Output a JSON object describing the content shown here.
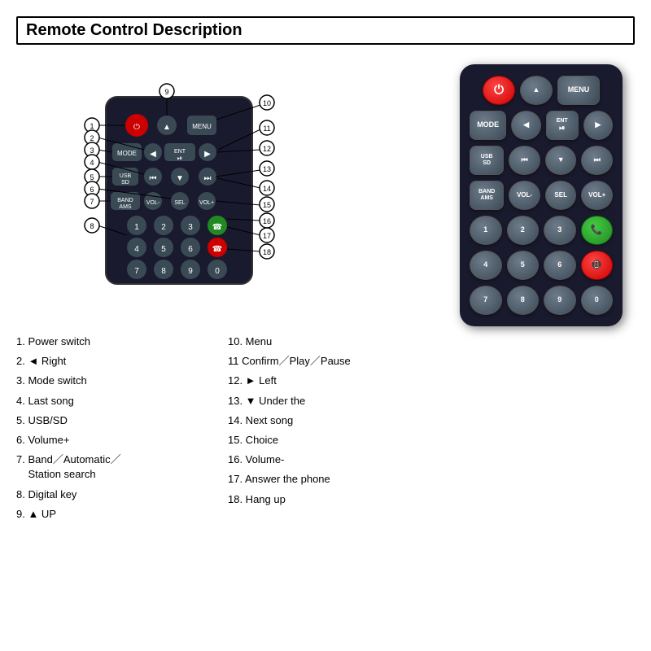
{
  "title": "Remote Control Description",
  "descriptions_left": [
    {
      "num": "1",
      "text": "Power switch"
    },
    {
      "num": "2",
      "text": "◄ Right"
    },
    {
      "num": "3",
      "text": "Mode switch"
    },
    {
      "num": "4",
      "text": "Last song"
    },
    {
      "num": "5",
      "text": "USB/SD"
    },
    {
      "num": "6",
      "text": "Volume+"
    },
    {
      "num": "7",
      "text": "Band／Automatic／Station search"
    },
    {
      "num": "8",
      "text": "Digital key"
    },
    {
      "num": "9",
      "text": "▲ UP"
    }
  ],
  "descriptions_right": [
    {
      "num": "10",
      "text": "Menu"
    },
    {
      "num": "11",
      "text": "Confirm／Play／Pause"
    },
    {
      "num": "12",
      "text": "► Left"
    },
    {
      "num": "13",
      "text": "▼ Under the"
    },
    {
      "num": "14",
      "text": "Next song"
    },
    {
      "num": "15",
      "text": "Choice"
    },
    {
      "num": "16",
      "text": "Volume-"
    },
    {
      "num": "17",
      "text": "Answer the phone"
    },
    {
      "num": "18",
      "text": "Hang up"
    }
  ],
  "remote": {
    "rows": [
      [
        {
          "label": "⏻",
          "type": "red-power",
          "name": "power"
        },
        {
          "label": "▲",
          "type": "gray",
          "name": "up"
        },
        {
          "label": "MENU",
          "type": "gray-wide",
          "name": "menu"
        }
      ],
      [
        {
          "label": "MODE",
          "type": "gray-wide",
          "name": "mode"
        },
        {
          "label": "◀",
          "type": "gray",
          "name": "left"
        },
        {
          "label": "ENT\n⏯",
          "type": "gray-wide",
          "name": "ent"
        },
        {
          "label": "▶",
          "type": "gray",
          "name": "right"
        }
      ],
      [
        {
          "label": "USB\nSD",
          "type": "gray-wide",
          "name": "usb"
        },
        {
          "label": "⏮",
          "type": "gray",
          "name": "prev"
        },
        {
          "label": "▼",
          "type": "gray",
          "name": "down"
        },
        {
          "label": "⏭",
          "type": "gray",
          "name": "next"
        }
      ],
      [
        {
          "label": "BAND\nAMS",
          "type": "gray-wide",
          "name": "band"
        },
        {
          "label": "VOL-",
          "type": "gray",
          "name": "vol-"
        },
        {
          "label": "SEL",
          "type": "gray",
          "name": "sel"
        },
        {
          "label": "VOL+",
          "type": "gray",
          "name": "vol+"
        }
      ],
      [
        {
          "label": "1",
          "type": "gray",
          "name": "1"
        },
        {
          "label": "2",
          "type": "gray",
          "name": "2"
        },
        {
          "label": "3",
          "type": "gray",
          "name": "3"
        },
        {
          "label": "📞",
          "type": "green",
          "name": "answer"
        }
      ],
      [
        {
          "label": "4",
          "type": "gray",
          "name": "4"
        },
        {
          "label": "5",
          "type": "gray",
          "name": "5"
        },
        {
          "label": "6",
          "type": "gray",
          "name": "6"
        },
        {
          "label": "📵",
          "type": "red-hangup",
          "name": "hangup"
        }
      ],
      [
        {
          "label": "7",
          "type": "gray",
          "name": "7"
        },
        {
          "label": "8",
          "type": "gray",
          "name": "8"
        },
        {
          "label": "9",
          "type": "gray",
          "name": "9"
        },
        {
          "label": "0",
          "type": "gray",
          "name": "0"
        }
      ]
    ]
  }
}
